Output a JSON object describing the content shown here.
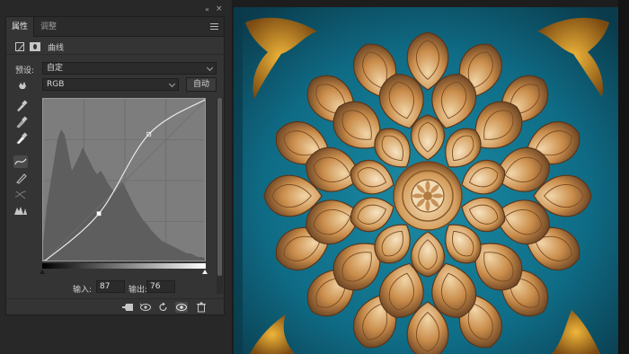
{
  "panel": {
    "tabs": [
      {
        "label": "属性",
        "active": true
      },
      {
        "label": "调整",
        "active": false
      }
    ],
    "layer_label": "曲线",
    "preset": {
      "label": "预设:",
      "value": "自定"
    },
    "channel": {
      "value": "RGB"
    },
    "auto_label": "自动",
    "input": {
      "label": "输入:",
      "value": "87"
    },
    "output": {
      "label": "输出:",
      "value": "76"
    },
    "curve_points": [
      {
        "input": 0,
        "output": 0
      },
      {
        "input": 87,
        "output": 76
      },
      {
        "input": 165,
        "output": 200
      },
      {
        "input": 255,
        "output": 255
      }
    ],
    "icons": {
      "collapse": "double-chevron-icon",
      "close": "close-icon",
      "menu": "menu-icon",
      "curves": "curves-icon",
      "mask": "mask-icon",
      "hand": "hand-icon",
      "tools": [
        "sample-black-eyedropper-icon",
        "sample-gray-eyedropper-icon",
        "sample-white-eyedropper-icon",
        "edit-points-icon",
        "pencil-icon",
        "smooth-icon",
        "clipping-warning-icon"
      ],
      "bottom": [
        "clip-to-layer-icon",
        "view-previous-icon",
        "reset-icon",
        "visibility-eye-icon",
        "trash-icon"
      ]
    }
  },
  "artwork": {
    "description_colors": {
      "background": "#0e6f8a",
      "petal": "#c8a070",
      "gold": "#d49a24"
    }
  }
}
